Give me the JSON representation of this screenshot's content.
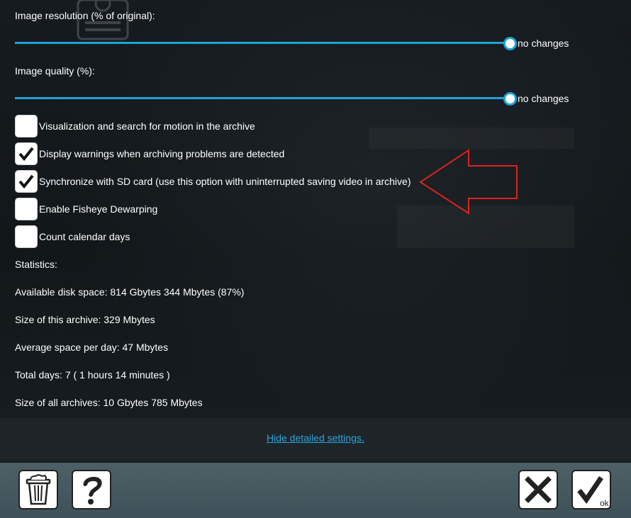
{
  "image_resolution": {
    "label": "Image resolution (% of original):",
    "value_text": "no changes",
    "level": 1.0
  },
  "image_quality": {
    "label": "Image quality (%):",
    "value_text": "no changes",
    "level": 1.0
  },
  "options": [
    {
      "label": "Visualization and search for motion in the archive",
      "checked": false
    },
    {
      "label": "Display warnings when archiving problems are detected",
      "checked": true
    },
    {
      "label": "Synchronize with SD card (use this option with uninterrupted saving video in archive)",
      "checked": true
    },
    {
      "label": "Enable Fisheye Dewarping",
      "checked": false
    },
    {
      "label": "Count calendar days",
      "checked": false
    }
  ],
  "statistics": {
    "heading": "Statistics:",
    "available_disk_space": "Available disk space: 814 Gbytes 344 Mbytes (87%)",
    "archive_size": "Size of this archive: 329 Mbytes",
    "average_per_day": "Average space per day: 47 Mbytes",
    "total_days": "Total days: 7 ( 1 hours 14 minutes )",
    "all_archives_size": "Size of all archives: 10 Gbytes 785 Mbytes"
  },
  "hide_link": "Hide detailed settings.",
  "footer": {
    "ok_label": "ok"
  },
  "colors": {
    "accent": "#1fa2d8",
    "annotation_arrow": "#e02020",
    "footer": "#465a60",
    "link": "#2aa6e0"
  }
}
